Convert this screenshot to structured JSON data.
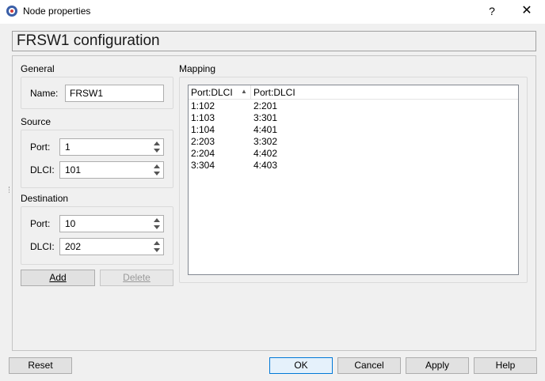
{
  "window": {
    "title": "Node properties",
    "help_label": "?",
    "close_label": "✕"
  },
  "banner": {
    "title": "FRSW1 configuration"
  },
  "general": {
    "title": "General",
    "name_label": "Name:",
    "name_value": "FRSW1"
  },
  "source": {
    "title": "Source",
    "port_label": "Port:",
    "port_value": "1",
    "dlci_label": "DLCI:",
    "dlci_value": "101"
  },
  "destination": {
    "title": "Destination",
    "port_label": "Port:",
    "port_value": "10",
    "dlci_label": "DLCI:",
    "dlci_value": "202"
  },
  "actions": {
    "add_label": "Add",
    "delete_label": "Delete"
  },
  "mapping": {
    "title": "Mapping",
    "columns": [
      "Port:DLCI",
      "Port:DLCI"
    ],
    "sort_indicator": "▲",
    "rows": [
      [
        "1:102",
        "2:201"
      ],
      [
        "1:103",
        "3:301"
      ],
      [
        "1:104",
        "4:401"
      ],
      [
        "2:203",
        "3:302"
      ],
      [
        "2:204",
        "4:402"
      ],
      [
        "3:304",
        "4:403"
      ]
    ]
  },
  "footer": {
    "reset_label": "Reset",
    "ok_label": "OK",
    "cancel_label": "Cancel",
    "apply_label": "Apply",
    "help_label": "Help"
  }
}
